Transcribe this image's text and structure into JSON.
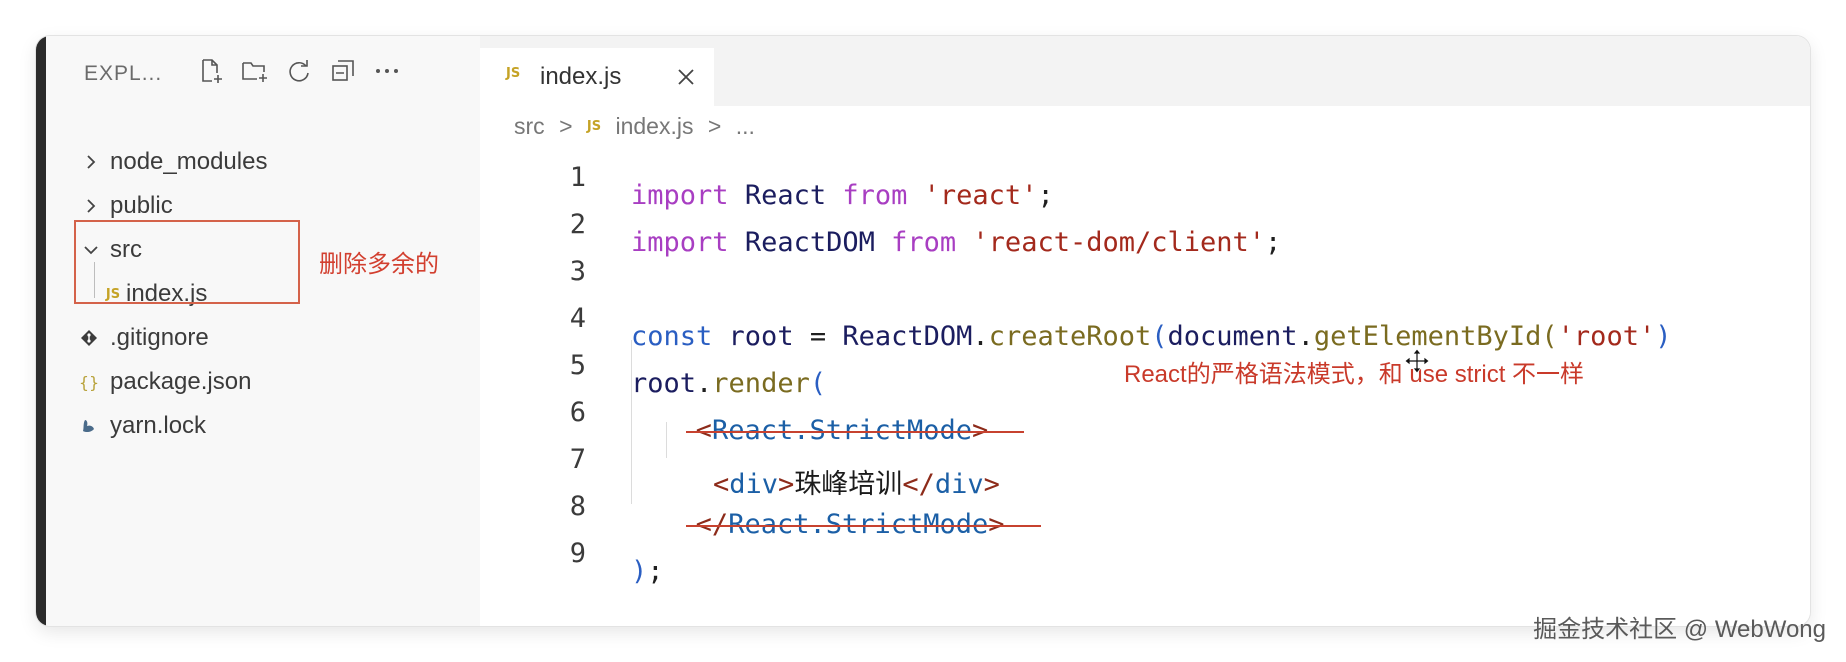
{
  "explorer": {
    "title": "EXPL...",
    "toolbar": [
      {
        "icon": "new-file-icon"
      },
      {
        "icon": "new-folder-icon"
      },
      {
        "icon": "refresh-icon"
      },
      {
        "icon": "collapse-all-icon"
      },
      {
        "icon": "more-icon"
      }
    ],
    "tree": [
      {
        "label": "node_modules",
        "kind": "folder",
        "expanded": false
      },
      {
        "label": "public",
        "kind": "folder",
        "expanded": false
      },
      {
        "label": "src",
        "kind": "folder",
        "expanded": true
      },
      {
        "label": "index.js",
        "kind": "js-file",
        "icon_text": "JS"
      },
      {
        "label": ".gitignore",
        "kind": "git-file"
      },
      {
        "label": "package.json",
        "kind": "json-file",
        "icon_text": "{}"
      },
      {
        "label": "yarn.lock",
        "kind": "yarn-file"
      }
    ],
    "annotation": "删除多余的"
  },
  "editor": {
    "tab": {
      "icon_text": "JS",
      "label": "index.js"
    },
    "breadcrumb": {
      "folder": "src",
      "separator": ">",
      "icon_text": "JS",
      "file": "index.js",
      "more": "..."
    },
    "lines": [
      {
        "num": "1",
        "t": [
          "import",
          "React",
          "from",
          "'react'",
          ";"
        ]
      },
      {
        "num": "2",
        "t": [
          "import",
          "ReactDOM",
          "from",
          "'react-dom/client'",
          ";"
        ]
      },
      {
        "num": "3",
        "t": []
      },
      {
        "num": "4",
        "t": [
          "const",
          "root",
          "=",
          "ReactDOM",
          ".",
          "createRoot",
          "(",
          "document",
          ".",
          "getElementById",
          "(",
          "'root'",
          ")"
        ]
      },
      {
        "num": "5",
        "t": [
          "root",
          ".",
          "render",
          "("
        ]
      },
      {
        "num": "6",
        "t": [
          "<",
          "React.StrictMode",
          ">"
        ]
      },
      {
        "num": "7",
        "t": [
          "<",
          "div",
          ">",
          "珠峰培训",
          "</",
          "div",
          ">"
        ]
      },
      {
        "num": "8",
        "t": [
          "</",
          "React.StrictMode",
          ">"
        ]
      },
      {
        "num": "9",
        "t": [
          ")",
          ";"
        ]
      }
    ],
    "annotation": "React的严格语法模式，和 use strict 不一样"
  },
  "watermark": "掘金技术社区 @ WebWong",
  "colors": {
    "annotation_red": "#d23f2f",
    "keyword": "#a83ec2",
    "string": "#a3291c",
    "function": "#7a6b20",
    "variable": "#1b1d5f",
    "js_icon": "#c5a326"
  }
}
